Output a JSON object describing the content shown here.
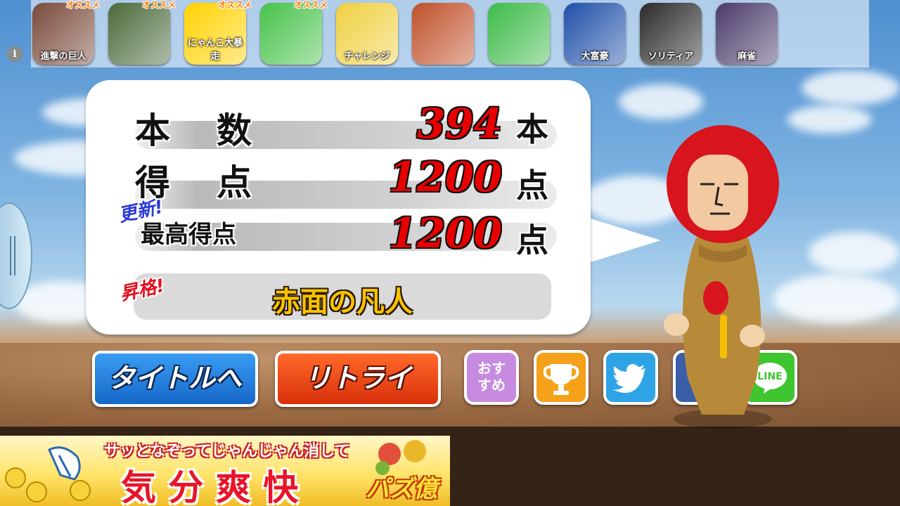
{
  "app_bar": {
    "info_icon": "i",
    "badge_text": "オススメ",
    "apps": [
      {
        "label": "進撃の巨人",
        "icon": "titan-icon",
        "color": "#7a4a3a",
        "badge": true
      },
      {
        "label": "",
        "icon": "general-icon",
        "color": "#4a6a3a",
        "badge": true
      },
      {
        "label": "にゃんこ大暴走",
        "icon": "cat-icon",
        "color": "#ffd200",
        "badge": true
      },
      {
        "label": "",
        "icon": "running-boy-icon",
        "color": "#47c24a",
        "badge": true
      },
      {
        "label": "チャレンジ",
        "icon": "stickman-bike-icon",
        "color": "#f0d040",
        "badge": false
      },
      {
        "label": "",
        "icon": "jungle-girl-icon",
        "color": "#c0502a",
        "badge": false
      },
      {
        "label": "",
        "icon": "butterfly-gem-icon",
        "color": "#3dbb49",
        "badge": false
      },
      {
        "label": "大富豪",
        "icon": "playing-cards-icon",
        "color": "#1f4fa8",
        "badge": false
      },
      {
        "label": "ソリティア",
        "icon": "solitaire-cards-icon",
        "color": "#2a2a2a",
        "badge": false
      },
      {
        "label": "麻雀",
        "icon": "mahjong-icon",
        "color": "#4a3a6a",
        "badge": false
      }
    ]
  },
  "result": {
    "rows": [
      {
        "label": "本　数",
        "value": "394",
        "unit": "本"
      },
      {
        "label": "得　点",
        "value": "1200",
        "unit": "点"
      },
      {
        "label": "最高得点",
        "value": "1200",
        "unit": "点"
      }
    ],
    "update_tag": "更新!",
    "promotion_tag": "昇格!",
    "rank_title": "赤面の凡人"
  },
  "buttons": {
    "title": "タイトルへ",
    "retry": "リトライ",
    "recommend": "おすすめ",
    "line": "LINE"
  },
  "social_icons": [
    "trophy-icon",
    "twitter-icon",
    "facebook-icon",
    "line-icon"
  ],
  "ad": {
    "headline": "サッとなぞってじゃんじゃん消して",
    "big_text": "気 分 爽 快",
    "logo": "パズ億"
  },
  "colors": {
    "title_button": "#1d7fe0",
    "retry_button": "#f14a10",
    "recommend": "#c68be0",
    "trophy": "#f5a11a",
    "twitter": "#2ea4e6",
    "facebook": "#3a5ea8",
    "line": "#3fc52f",
    "character_head": "#d8141c",
    "character_suit": "#b78a3a"
  }
}
